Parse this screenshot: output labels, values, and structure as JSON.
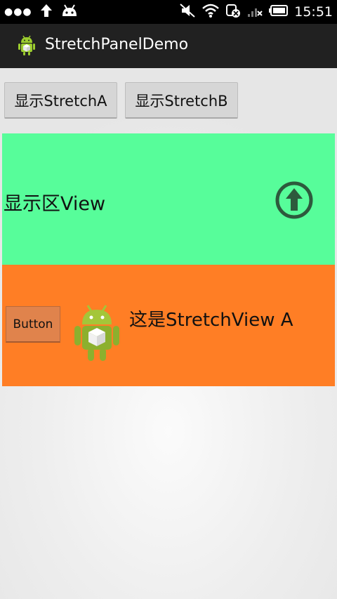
{
  "status_bar": {
    "time": "15:51",
    "left_icons": [
      "dots-icon",
      "upload-arrow-icon",
      "android-head-icon"
    ],
    "right_icons": [
      "mute-icon",
      "wifi-icon",
      "data-off-icon",
      "signal-icon",
      "battery-icon"
    ]
  },
  "action_bar": {
    "title": "StretchPanelDemo",
    "app_icon": "android-app-icon"
  },
  "buttons": {
    "show_a": "显示StretchA",
    "show_b": "显示StretchB"
  },
  "display_area": {
    "label": "显示区View",
    "icon": "up-arrow-circle-icon",
    "color": "#57fd9a"
  },
  "stretch_view_a": {
    "button_label": "Button",
    "label": "这是StretchView A",
    "icon": "android-robot-icon",
    "color": "#ff7e25"
  }
}
